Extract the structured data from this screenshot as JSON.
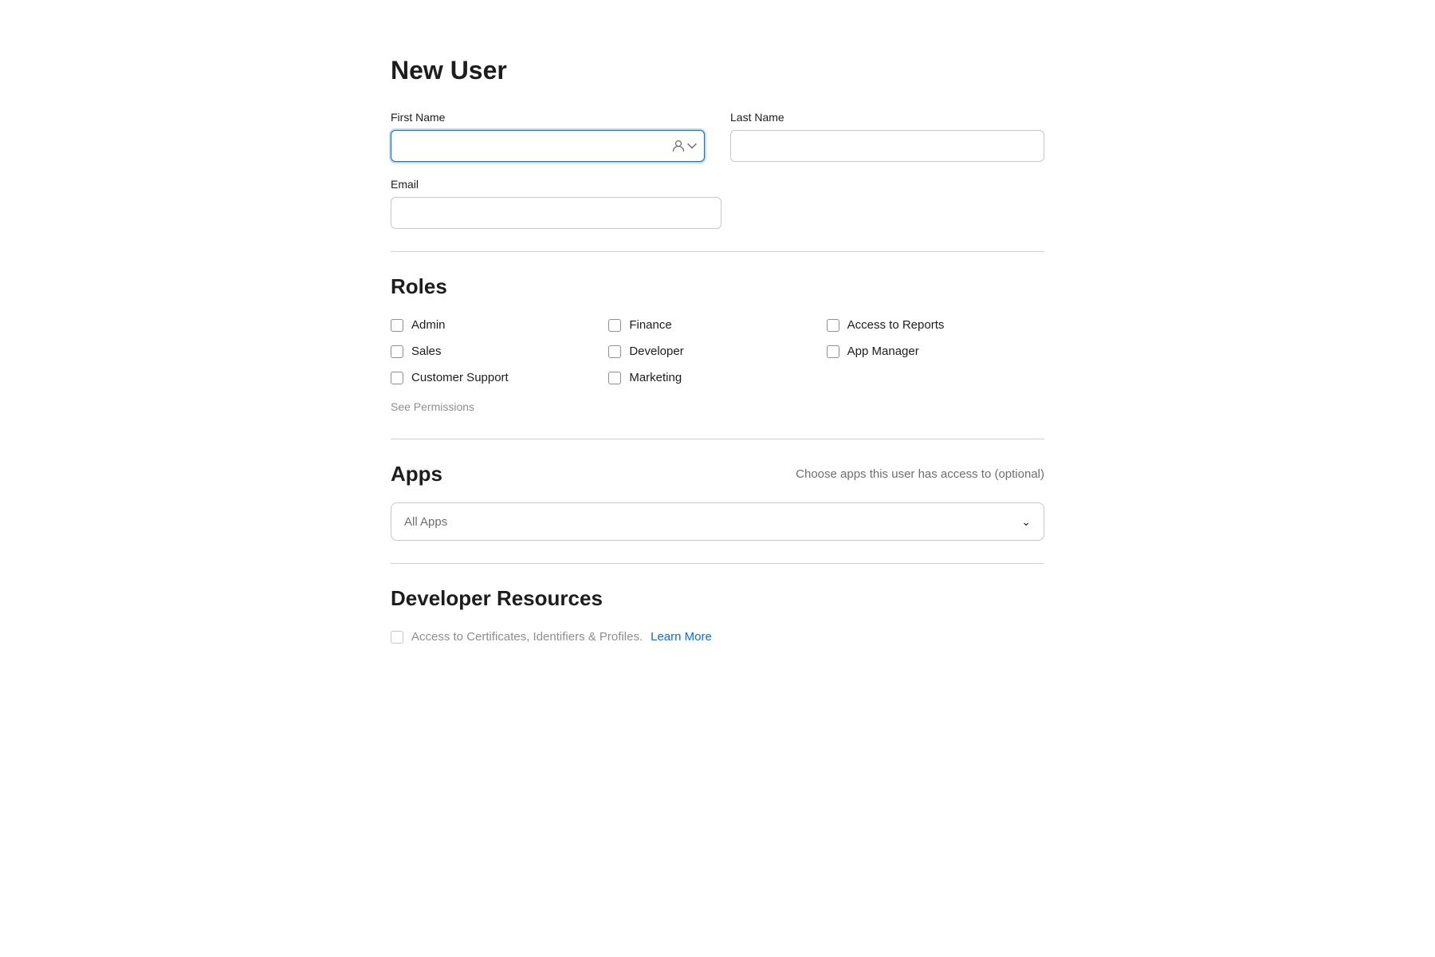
{
  "page": {
    "title": "New User"
  },
  "form": {
    "first_name_label": "First Name",
    "last_name_label": "Last Name",
    "email_label": "Email",
    "first_name_placeholder": "",
    "last_name_placeholder": "",
    "email_placeholder": ""
  },
  "roles": {
    "section_title": "Roles",
    "see_permissions_label": "See Permissions",
    "column1": [
      {
        "id": "admin",
        "label": "Admin",
        "checked": false
      },
      {
        "id": "sales",
        "label": "Sales",
        "checked": false
      },
      {
        "id": "customer_support",
        "label": "Customer Support",
        "checked": false
      }
    ],
    "column2": [
      {
        "id": "finance",
        "label": "Finance",
        "checked": false
      },
      {
        "id": "developer",
        "label": "Developer",
        "checked": false
      },
      {
        "id": "marketing",
        "label": "Marketing",
        "checked": false
      }
    ],
    "column3": [
      {
        "id": "access_to_reports",
        "label": "Access to Reports",
        "checked": false
      },
      {
        "id": "app_manager",
        "label": "App Manager",
        "checked": false
      }
    ]
  },
  "apps": {
    "section_title": "Apps",
    "subtitle": "Choose apps this user has access to (optional)",
    "dropdown_placeholder": "All Apps",
    "dropdown_options": [
      "All Apps"
    ]
  },
  "developer_resources": {
    "section_title": "Developer Resources",
    "cert_text": "Access to Certificates, Identifiers & Profiles.",
    "learn_more_label": "Learn More"
  },
  "icons": {
    "person_icon": "⊙",
    "chevron_down": "∨",
    "dropdown_chevron": "⌄"
  }
}
